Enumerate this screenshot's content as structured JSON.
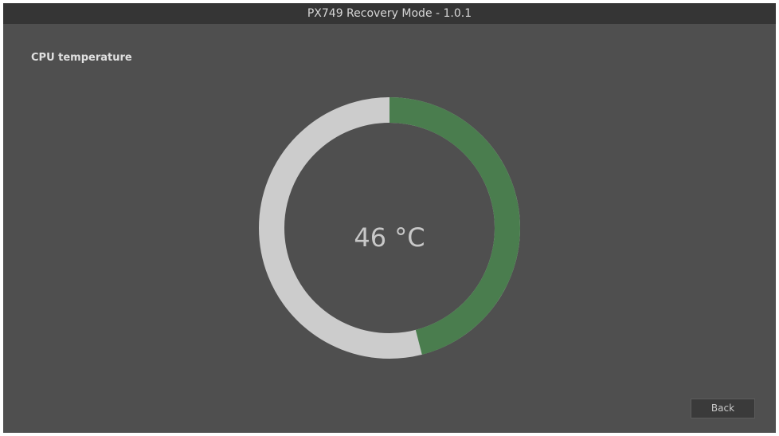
{
  "window": {
    "title": "PX749 Recovery Mode - 1.0.1"
  },
  "section": {
    "title": "CPU temperature"
  },
  "gauge": {
    "value_label": "46 °C",
    "fraction": 0.46,
    "fill_color": "#4a7d4e",
    "track_color": "#cccccc"
  },
  "buttons": {
    "back_label": "Back"
  }
}
